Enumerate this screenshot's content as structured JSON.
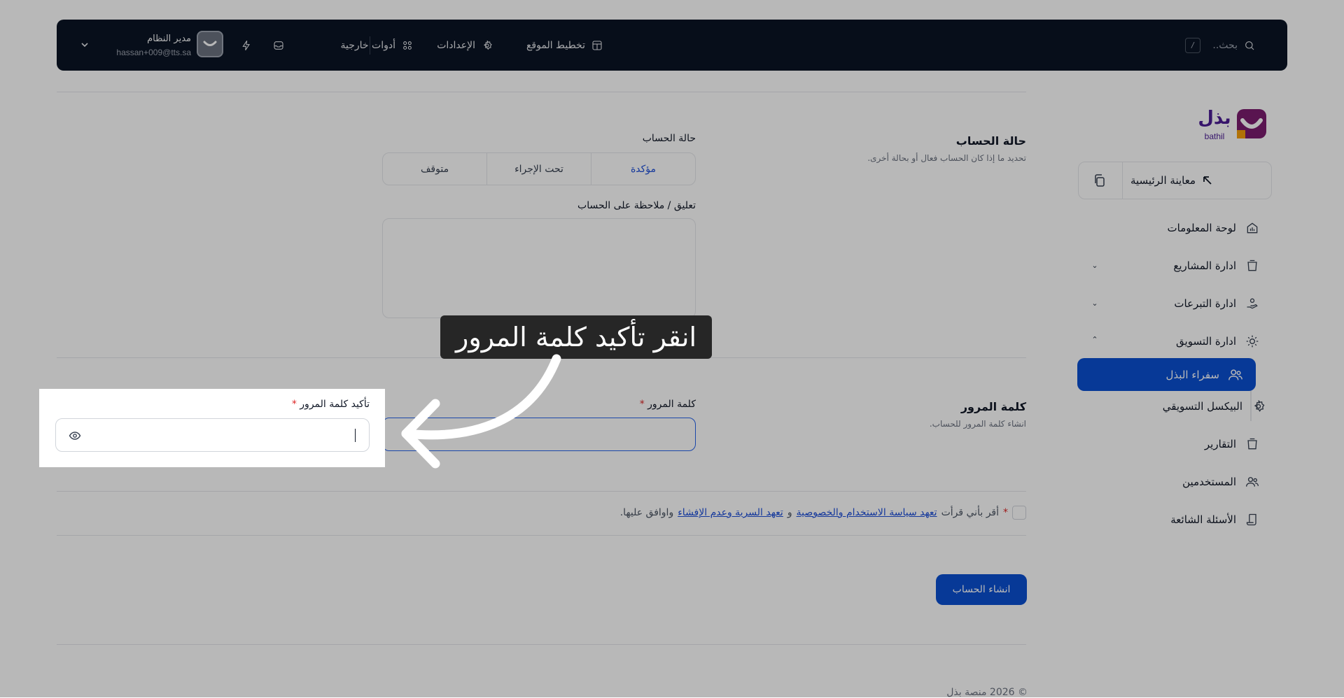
{
  "topbar": {
    "search_placeholder": "بحث..",
    "search_shortcut": "/",
    "menu": [
      {
        "label": "تخطيط الموقع",
        "icon": "layout-icon"
      },
      {
        "label": "الإعدادات",
        "icon": "gear-icon"
      },
      {
        "label": "أدوات خارجية",
        "icon": "grid-icon"
      }
    ],
    "user_name": "مدير النظام",
    "user_email": "hassan+009@tts.sa"
  },
  "sidebar": {
    "logo_text": "بذل",
    "logo_subtext": "bathil",
    "preview_label": "معاينة الرئيسية",
    "items": [
      {
        "label": "لوحة المعلومات",
        "icon": "dashboard-icon"
      },
      {
        "label": "ادارة المشاريع",
        "icon": "layers-icon"
      },
      {
        "label": "ادارة التبرعات",
        "icon": "hand-heart-icon"
      },
      {
        "label": "ادارة التسويق",
        "icon": "sun-icon"
      },
      {
        "label": "سفراء البذل",
        "icon": "users-icon"
      },
      {
        "label": "البيكسل التسويقي",
        "icon": "gear-icon"
      },
      {
        "label": "التقارير",
        "icon": "layers-icon"
      },
      {
        "label": "المستخدمين",
        "icon": "users-icon"
      },
      {
        "label": "الأسئلة الشائعة",
        "icon": "scroll-icon"
      }
    ]
  },
  "account_status": {
    "title": "حالة الحساب",
    "description": "تحديد ما إذا كان الحساب فعال أو بحالة أخرى.",
    "field_label": "حالة الحساب",
    "options": [
      "مؤكدة",
      "تحت الإجراء",
      "متوقف"
    ],
    "selected": "مؤكدة",
    "comment_label": "تعليق / ملاحظة على الحساب"
  },
  "password": {
    "title": "كلمة المرور",
    "description": "انشاء كلمة المرور للحساب.",
    "password_label": "كلمة المرور",
    "confirm_label": "تأكيد كلمة المرور",
    "required_mark": "*"
  },
  "agreement": {
    "required_mark": "*",
    "prefix": "أقر بأني قرأت",
    "link1": "تعهد سياسة الاستخدام والخصوصية",
    "middle": "و",
    "link2": "تعهد السرية وعدم الإفشاء",
    "suffix": "واوافق عليها."
  },
  "actions": {
    "create_label": "انشاء الحساب"
  },
  "footer": {
    "copyright": "© 2026 منصة بذل"
  },
  "tutorial": {
    "tooltip": "انقر تأكيد كلمة المرور"
  },
  "colors": {
    "topbar": "#0b1424",
    "accent": "#0b4fd1",
    "required": "#dc2626"
  }
}
